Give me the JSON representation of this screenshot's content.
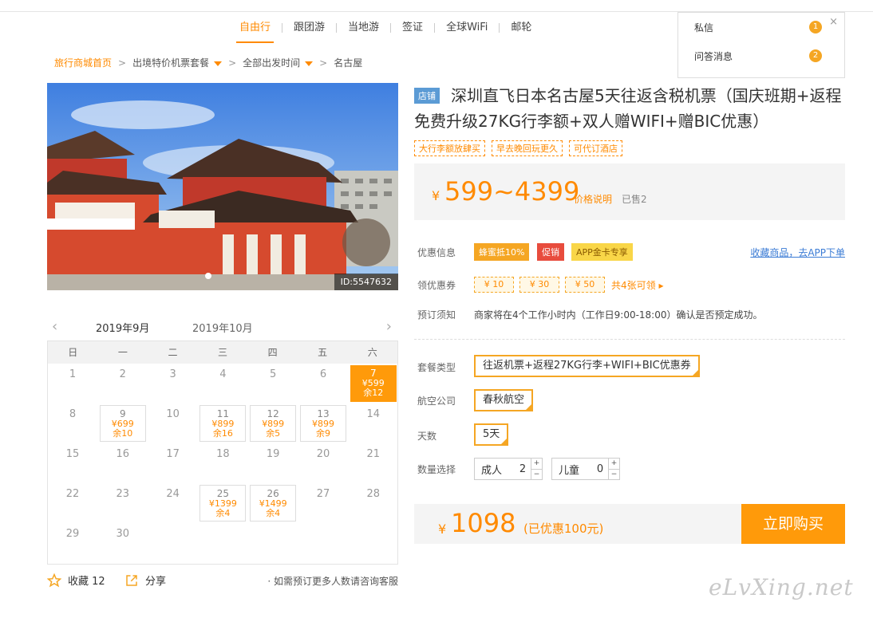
{
  "nav": {
    "items": [
      {
        "label": "自由行",
        "active": true
      },
      {
        "label": "跟团游"
      },
      {
        "label": "当地游"
      },
      {
        "label": "签证"
      },
      {
        "label": "全球WiFi"
      },
      {
        "label": "邮轮"
      }
    ]
  },
  "messages": {
    "items": [
      {
        "label": "私信",
        "count": "1"
      },
      {
        "label": "问答消息",
        "count": "2"
      }
    ],
    "close": "×"
  },
  "breadcrumb": {
    "home": "旅行商城首页",
    "package": "出境特价机票套餐",
    "departure": "全部出发时间",
    "current": "名古屋"
  },
  "photo": {
    "id_label": "ID:5547632"
  },
  "calendar": {
    "months": [
      "2019年9月",
      "2019年10月"
    ],
    "weekdays": [
      "日",
      "一",
      "二",
      "三",
      "四",
      "五",
      "六"
    ],
    "days": [
      {
        "d": "1"
      },
      {
        "d": "2"
      },
      {
        "d": "3"
      },
      {
        "d": "4"
      },
      {
        "d": "5"
      },
      {
        "d": "6"
      },
      {
        "d": "7",
        "price": "¥599",
        "remain": "余12",
        "selected": true
      },
      {
        "d": "8"
      },
      {
        "d": "9",
        "price": "¥699",
        "remain": "余10"
      },
      {
        "d": "10"
      },
      {
        "d": "11",
        "price": "¥899",
        "remain": "余16"
      },
      {
        "d": "12",
        "price": "¥899",
        "remain": "余5"
      },
      {
        "d": "13",
        "price": "¥899",
        "remain": "余9"
      },
      {
        "d": "14"
      },
      {
        "d": "15"
      },
      {
        "d": "16"
      },
      {
        "d": "17"
      },
      {
        "d": "18"
      },
      {
        "d": "19"
      },
      {
        "d": "20"
      },
      {
        "d": "21"
      },
      {
        "d": "22"
      },
      {
        "d": "23"
      },
      {
        "d": "24"
      },
      {
        "d": "25",
        "price": "¥1399",
        "remain": "余4"
      },
      {
        "d": "26",
        "price": "¥1499",
        "remain": "余4"
      },
      {
        "d": "27"
      },
      {
        "d": "28"
      },
      {
        "d": "29"
      },
      {
        "d": "30"
      }
    ]
  },
  "actions": {
    "favorite": "收藏 12",
    "share": "分享",
    "consult": "· 如需预订更多人数请咨询客服"
  },
  "product": {
    "shop_tag": "店铺",
    "title": "深圳直飞日本名古屋5天往返含税机票（国庆班期+返程免费升级27KG行李额+双人赠WIFI+赠BIC优惠）",
    "tags": [
      "大行李额放肆买",
      "早去晚回玩更久",
      "可代订酒店"
    ],
    "price_yen": "¥",
    "price_range": "599~4399",
    "price_desc": "价格说明",
    "sold": "已售2"
  },
  "promo": {
    "label": "优惠信息",
    "badges": [
      {
        "text": "蜂蜜抵10%",
        "color": "#f5a623"
      },
      {
        "text": "促销",
        "color": "#e84c3d"
      },
      {
        "text": "APP金卡专享",
        "color": "#f9d648"
      }
    ],
    "fav_link": "收藏商品，去APP下单"
  },
  "coupons": {
    "label": "领优惠券",
    "items": [
      "¥ 10",
      "¥ 30",
      "¥ 50"
    ],
    "more": "共4张可领 ▸"
  },
  "notice": {
    "label": "预订须知",
    "text": "商家将在4个工作小时内（工作日9:00-18:00）确认是否预定成功。"
  },
  "options": {
    "package_label": "套餐类型",
    "package_value": "往返机票+返程27KG行李+WIFI+BIC优惠券",
    "airline_label": "航空公司",
    "airline_value": "春秋航空",
    "days_label": "天数",
    "days_value": "5天",
    "qty_label": "数量选择",
    "adult_label": "成人",
    "adult_value": "2",
    "child_label": "儿童",
    "child_value": "0"
  },
  "total": {
    "yen": "¥",
    "amount": "1098",
    "saved": "(已优惠100元)",
    "buy": "立即购买"
  },
  "watermark": "eLvXing.net"
}
